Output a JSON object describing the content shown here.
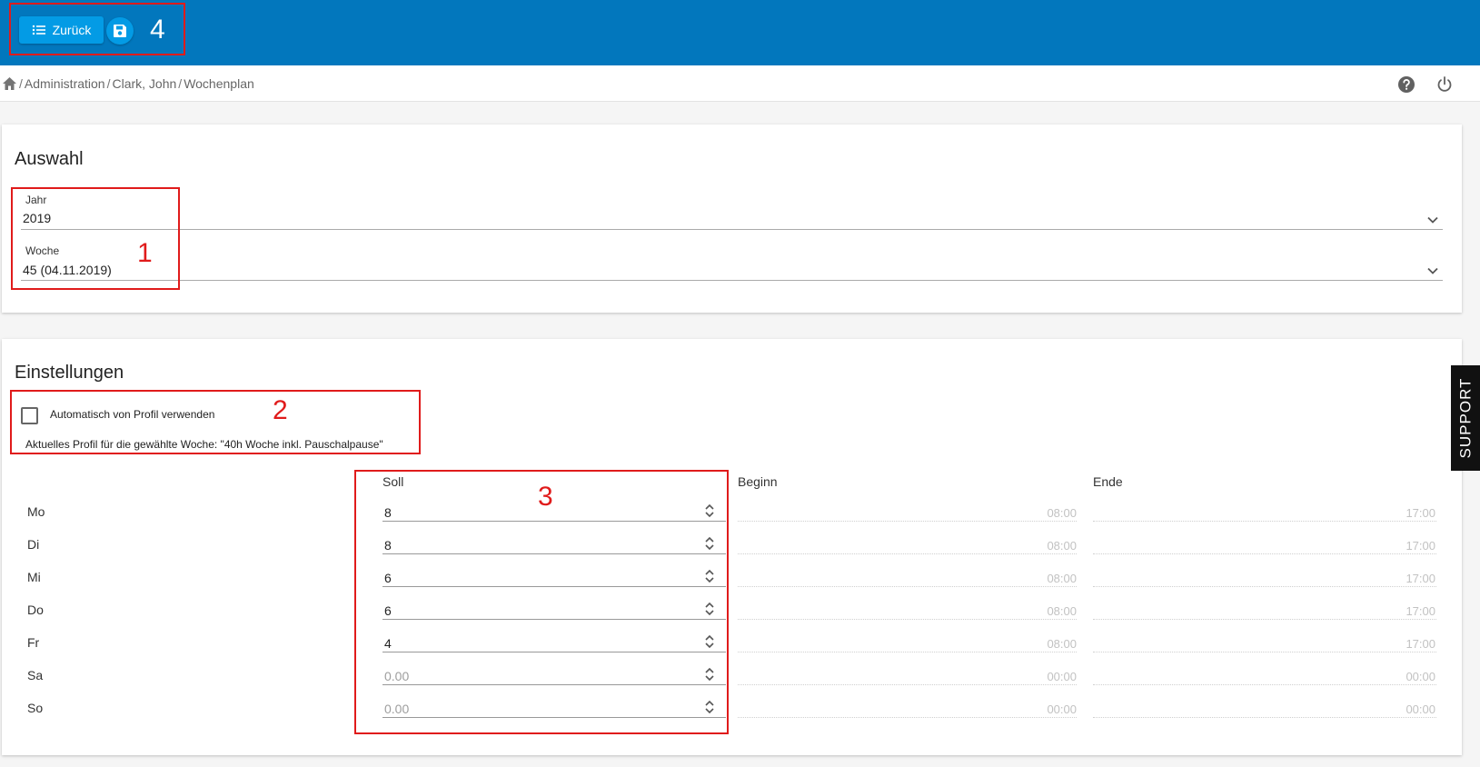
{
  "toolbar": {
    "back_label": "Zurück",
    "save_icon": "save-icon",
    "annotation": "4"
  },
  "breadcrumb": {
    "home_icon": "home-icon",
    "items": [
      "Administration",
      "Clark, John",
      "Wochenplan"
    ],
    "separator": "/"
  },
  "header_icons": [
    "help-icon",
    "power-icon"
  ],
  "auswahl": {
    "title": "Auswahl",
    "jahr_label": "Jahr",
    "jahr_value": "2019",
    "woche_label": "Woche",
    "woche_value": "45 (04.11.2019)",
    "annotation": "1"
  },
  "einstellungen": {
    "title": "Einstellungen",
    "auto_profile_label": "Automatisch von Profil verwenden",
    "auto_profile_checked": false,
    "current_profile_text": "Aktuelles Profil für die gewählte Woche: \"40h Woche inkl. Pauschalpause\"",
    "annotation_settings": "2",
    "annotation_soll": "3",
    "columns": {
      "soll": "Soll",
      "beginn": "Beginn",
      "ende": "Ende"
    },
    "days": [
      {
        "day": "Mo",
        "soll": "8",
        "beginn": "08:00",
        "ende": "17:00",
        "soll_placeholder": false
      },
      {
        "day": "Di",
        "soll": "8",
        "beginn": "08:00",
        "ende": "17:00",
        "soll_placeholder": false
      },
      {
        "day": "Mi",
        "soll": "6",
        "beginn": "08:00",
        "ende": "17:00",
        "soll_placeholder": false
      },
      {
        "day": "Do",
        "soll": "6",
        "beginn": "08:00",
        "ende": "17:00",
        "soll_placeholder": false
      },
      {
        "day": "Fr",
        "soll": "4",
        "beginn": "08:00",
        "ende": "17:00",
        "soll_placeholder": false
      },
      {
        "day": "Sa",
        "soll": "0.00",
        "beginn": "00:00",
        "ende": "00:00",
        "soll_placeholder": true
      },
      {
        "day": "So",
        "soll": "0.00",
        "beginn": "00:00",
        "ende": "00:00",
        "soll_placeholder": true
      }
    ]
  },
  "support_label": "SUPPORT",
  "colors": {
    "header_bg": "#0277bd",
    "button_bg": "#039be5",
    "annotation": "#e01b1b"
  }
}
